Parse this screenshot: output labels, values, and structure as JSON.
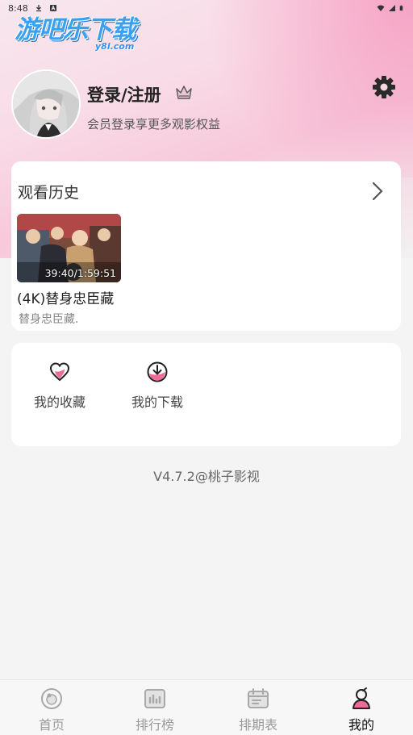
{
  "status_bar": {
    "time": "8:48",
    "icons": [
      "download-icon",
      "notification-a-icon",
      "wifi-icon",
      "signal-icon",
      "battery-icon"
    ]
  },
  "logo": {
    "text": "游吧乐下载",
    "sub": "y8l.com"
  },
  "user": {
    "login_label": "登录/注册",
    "subtitle": "会员登录享更多观影权益"
  },
  "history": {
    "title": "观看历史",
    "items": [
      {
        "progress": "39:40/1:59:51",
        "title": "(4K)替身忠臣藏",
        "subtitle": "替身忠臣藏."
      }
    ]
  },
  "menu": {
    "favorites_label": "我的收藏",
    "downloads_label": "我的下载"
  },
  "version": "V4.7.2@桃子影视",
  "bottom_nav": [
    {
      "label": "首页",
      "icon": "home-icon",
      "active": false
    },
    {
      "label": "排行榜",
      "icon": "ranking-icon",
      "active": false
    },
    {
      "label": "排期表",
      "icon": "schedule-icon",
      "active": false
    },
    {
      "label": "我的",
      "icon": "profile-icon",
      "active": true
    }
  ],
  "colors": {
    "accent_pink": "#f06a9a",
    "logo_blue": "#3aa0f0",
    "text_dark": "#222222",
    "nav_inactive": "#9a9a9a"
  }
}
